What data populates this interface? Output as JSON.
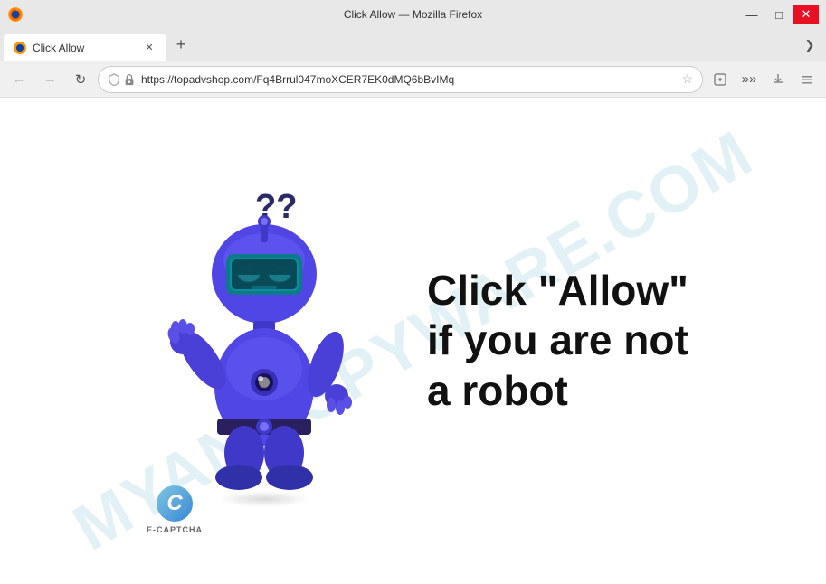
{
  "window": {
    "title": "Click Allow — Mozilla Firefox",
    "controls": {
      "minimize": "—",
      "maximize": "□",
      "close": "✕"
    }
  },
  "tab": {
    "label": "Click Allow",
    "close": "✕"
  },
  "new_tab_btn": "+",
  "tabs_expand_btn": "❯",
  "nav": {
    "back": "←",
    "forward": "→",
    "refresh": "↻",
    "url": "https://topadvshop.com/Fq4Brrul047moXCER7EK0dMQ6bBvIMq",
    "shield_icon": "🛡",
    "lock_icon": "🔒"
  },
  "page": {
    "message_line1": "Click \"Allow\"",
    "message_line2": "if you are not",
    "message_line3": "a robot",
    "watermark": "MYANTISPYWARE.COM",
    "ecaptcha_label": "E-CAPTCHA",
    "ecaptcha_c": "C"
  }
}
